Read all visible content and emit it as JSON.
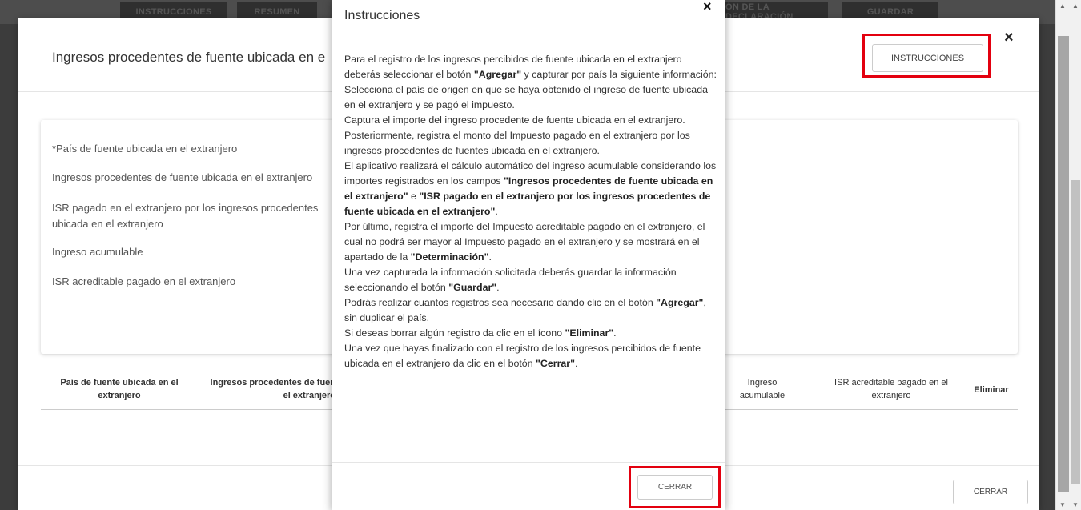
{
  "topnav": {
    "tabs": [
      "INSTRUCCIONES",
      "RESUMEN",
      "ÓN DE LA DECLARACIÓN",
      "GUARDAR"
    ]
  },
  "outer_modal": {
    "title": "Ingresos procedentes de fuente ubicada en e",
    "close_icon": "×",
    "instructions_button": "INSTRUCCIONES",
    "form_labels": [
      "*País de fuente ubicada en el extranjero",
      "Ingresos procedentes de fuente ubicada en el extranjero",
      "ISR pagado en el extranjero por los ingresos procedentes",
      "ubicada en el extranjero",
      "Ingreso acumulable",
      "ISR acreditable pagado en el extranjero"
    ],
    "table_headers": [
      "País de fuente ubicada en el\nextranjero",
      "Ingresos procedentes de fuen\nel extranjero",
      "Ingreso\nacumulable",
      "ISR acreditable pagado en el\nextranjero",
      "Eliminar"
    ],
    "close_button": "CERRAR"
  },
  "instructions_modal": {
    "title": "Instrucciones",
    "close_icon": "×",
    "close_button": "CERRAR",
    "paragraphs": [
      [
        {
          "t": "Para el registro de los ingresos percibidos de fuente ubicada en el extranjero deberás seleccionar el botón "
        },
        {
          "b": "\"Agregar\""
        },
        {
          "t": " y capturar por país la siguiente información:"
        }
      ],
      [
        {
          "t": "Selecciona el país de origen en que se haya obtenido el ingreso de fuente ubicada en el extranjero y se pagó el impuesto."
        }
      ],
      [
        {
          "t": "Captura el importe del ingreso procedente de fuente ubicada en el extranjero."
        }
      ],
      [
        {
          "t": "Posteriormente, registra el monto del Impuesto pagado en el extranjero por los ingresos procedentes de fuentes ubicada en el extranjero."
        }
      ],
      [
        {
          "t": "El aplicativo realizará el cálculo automático del ingreso acumulable considerando los importes registrados en los campos "
        },
        {
          "b": "\"Ingresos procedentes de fuente ubicada en el extranjero\""
        },
        {
          "t": " e "
        },
        {
          "b": "\"ISR pagado en el extranjero por los ingresos procedentes de fuente ubicada en el extranjero\""
        },
        {
          "t": "."
        }
      ],
      [
        {
          "t": "Por último, registra el importe del Impuesto acreditable pagado en el extranjero, el cual no podrá ser mayor al Impuesto pagado en el extranjero y se mostrará en el apartado de la "
        },
        {
          "b": "\"Determinación\""
        },
        {
          "t": "."
        }
      ],
      [
        {
          "t": "Una vez capturada la información solicitada deberás guardar la información seleccionando el botón "
        },
        {
          "b": "\"Guardar\""
        },
        {
          "t": "."
        }
      ],
      [
        {
          "t": "Podrás realizar cuantos registros sea necesario dando clic en el botón "
        },
        {
          "b": "\"Agregar\""
        },
        {
          "t": ", sin duplicar el país."
        }
      ],
      [
        {
          "t": "Si deseas borrar algún registro da clic en el ícono "
        },
        {
          "b": "\"Eliminar\""
        },
        {
          "t": "."
        }
      ],
      [
        {
          "t": "Una vez que hayas finalizado con el registro de los ingresos percibidos de fuente ubicada en el extranjero da clic en el botón "
        },
        {
          "b": "\"Cerrar\""
        },
        {
          "t": "."
        }
      ]
    ]
  },
  "colors": {
    "highlight": "#e3000f",
    "overlay": "#3c3c3c"
  }
}
